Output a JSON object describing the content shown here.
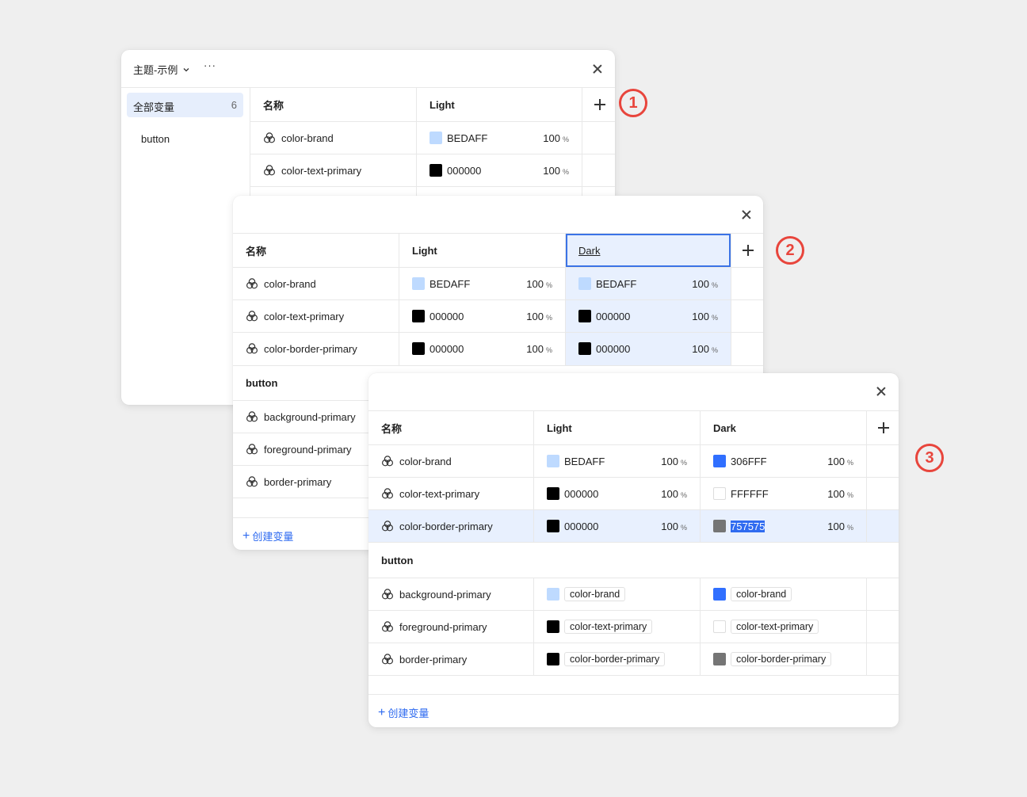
{
  "badges": [
    "1",
    "2",
    "3"
  ],
  "panel1": {
    "title": "主题-示例",
    "more": "···",
    "sidebar": [
      {
        "label": "全部变量",
        "count": "6"
      },
      {
        "label": "button"
      }
    ],
    "headers": {
      "name": "名称",
      "light": "Light"
    },
    "rows": [
      {
        "name": "color-brand",
        "hex": "BEDAFF",
        "pct": "100",
        "color": "#BEDAFF"
      },
      {
        "name": "color-text-primary",
        "hex": "000000",
        "pct": "100",
        "color": "#000000"
      }
    ]
  },
  "panel2": {
    "headers": {
      "name": "名称",
      "light": "Light",
      "dark": "Dark"
    },
    "rows": [
      {
        "name": "color-brand",
        "light_hex": "BEDAFF",
        "light_pct": "100",
        "light_color": "#BEDAFF",
        "dark_hex": "BEDAFF",
        "dark_pct": "100",
        "dark_color": "#BEDAFF"
      },
      {
        "name": "color-text-primary",
        "light_hex": "000000",
        "light_pct": "100",
        "light_color": "#000000",
        "dark_hex": "000000",
        "dark_pct": "100",
        "dark_color": "#000000"
      },
      {
        "name": "color-border-primary",
        "light_hex": "000000",
        "light_pct": "100",
        "light_color": "#000000",
        "dark_hex": "000000",
        "dark_pct": "100",
        "dark_color": "#000000"
      }
    ],
    "group": "button",
    "group_rows": [
      {
        "name": "background-primary"
      },
      {
        "name": "foreground-primary"
      },
      {
        "name": "border-primary"
      }
    ],
    "create": "创建变量"
  },
  "panel3": {
    "headers": {
      "name": "名称",
      "light": "Light",
      "dark": "Dark"
    },
    "rows": [
      {
        "name": "color-brand",
        "light_hex": "BEDAFF",
        "light_pct": "100",
        "light_color": "#BEDAFF",
        "dark_hex": "306FFF",
        "dark_pct": "100",
        "dark_color": "#306FFF"
      },
      {
        "name": "color-text-primary",
        "light_hex": "000000",
        "light_pct": "100",
        "light_color": "#000000",
        "dark_hex": "FFFFFF",
        "dark_pct": "100",
        "dark_color": "#FFFFFF"
      },
      {
        "name": "color-border-primary",
        "light_hex": "000000",
        "light_pct": "100",
        "light_color": "#000000",
        "dark_hex": "757575",
        "dark_pct": "100",
        "dark_color": "#757575"
      }
    ],
    "group": "button",
    "group_rows": [
      {
        "name": "background-primary",
        "light_ref": "color-brand",
        "light_color": "#BEDAFF",
        "dark_ref": "color-brand",
        "dark_color": "#306FFF"
      },
      {
        "name": "foreground-primary",
        "light_ref": "color-text-primary",
        "light_color": "#000000",
        "dark_ref": "color-text-primary",
        "dark_color": "#FFFFFF"
      },
      {
        "name": "border-primary",
        "light_ref": "color-border-primary",
        "light_color": "#000000",
        "dark_ref": "color-border-primary",
        "dark_color": "#757575"
      }
    ],
    "create": "创建变量"
  },
  "colors": {
    "accent": "#2f6bf0",
    "selection_bg": "#e8f0fe",
    "badge": "#e8453c"
  }
}
